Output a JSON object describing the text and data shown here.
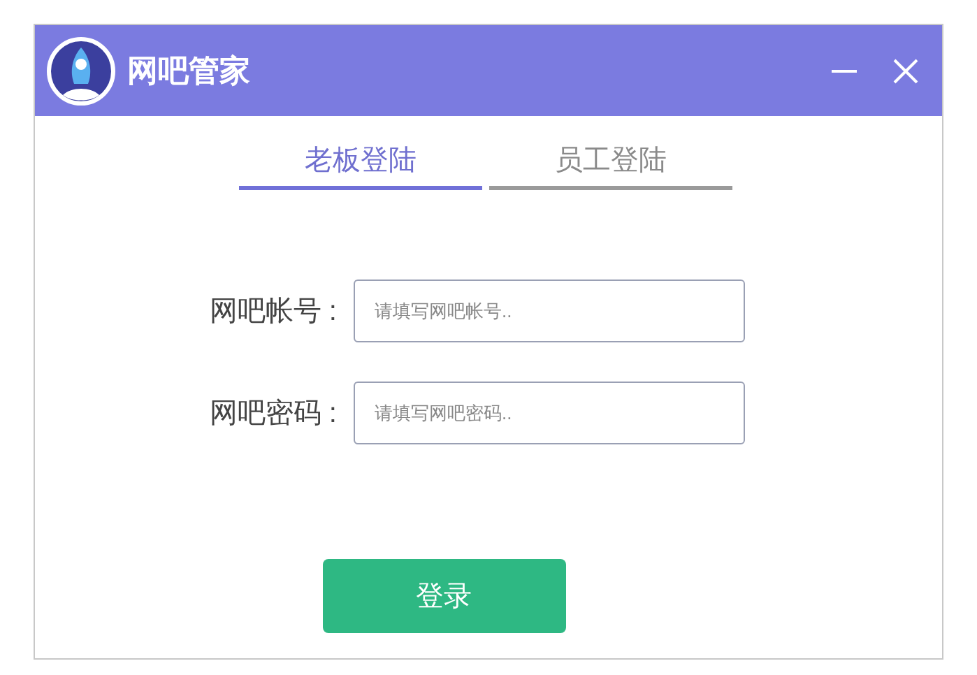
{
  "window": {
    "title": "网吧管家"
  },
  "tabs": [
    {
      "label": "老板登陆",
      "selected": true
    },
    {
      "label": "员工登陆",
      "selected": false
    }
  ],
  "fields": [
    {
      "label": "网吧帐号 :",
      "placeholder": "请填写网吧帐号.."
    },
    {
      "label": "网吧密码 :",
      "placeholder": "请填写网吧密码.."
    }
  ],
  "login_button": "登录"
}
